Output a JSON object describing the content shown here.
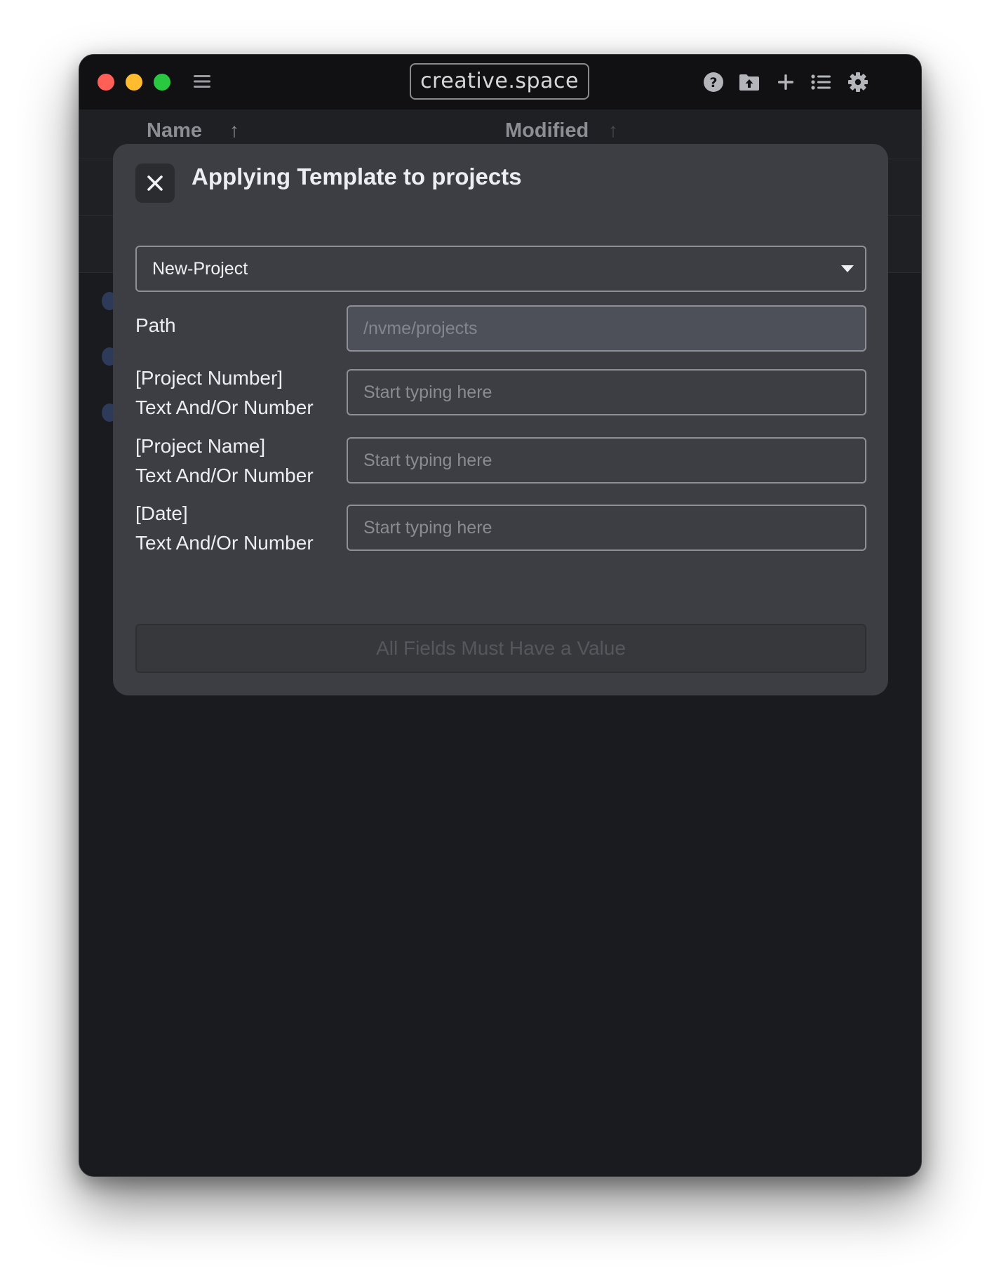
{
  "titlebar": {
    "brand": "creative.space",
    "icons": [
      "menu-icon",
      "help-icon",
      "folder-upload-icon",
      "plus-icon",
      "list-icon",
      "gear-icon"
    ]
  },
  "list_header": {
    "name_label": "Name",
    "modified_label": "Modified"
  },
  "dialog": {
    "title": "Applying Template to projects",
    "template_select": {
      "value": "New-Project"
    },
    "fields": [
      {
        "label_line1": "Path",
        "label_line2": "",
        "value": "",
        "placeholder": "/nvme/projects",
        "disabled": true
      },
      {
        "label_line1": "[Project Number]",
        "label_line2": "Text And/Or Number",
        "value": "",
        "placeholder": "Start typing here"
      },
      {
        "label_line1": "[Project Name]",
        "label_line2": "Text And/Or Number",
        "value": "",
        "placeholder": "Start typing here"
      },
      {
        "label_line1": "[Date]",
        "label_line2": "Text And/Or Number",
        "value": "",
        "placeholder": "Start typing here"
      }
    ],
    "submit_label": "All Fields Must Have a Value"
  },
  "colors": {
    "window_bg": "#1a1b1e",
    "dialog_bg": "#3d3e43",
    "close_red": "#ff5f57",
    "minimize_yellow": "#febc2e",
    "zoom_green": "#28c840"
  }
}
